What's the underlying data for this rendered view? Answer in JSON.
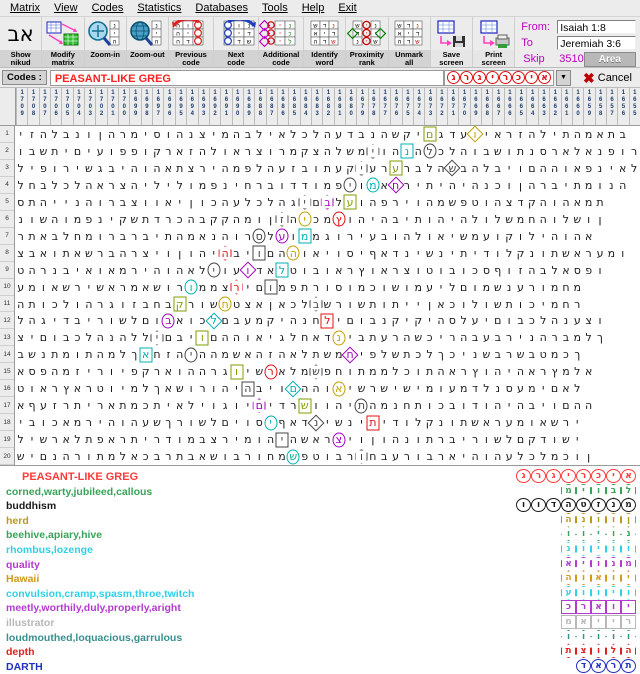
{
  "menu": {
    "items": [
      "Matrix",
      "View",
      "Codes",
      "Statistics",
      "Databases",
      "Tools",
      "Help",
      "Exit"
    ]
  },
  "toolbar": {
    "buttons": [
      {
        "label_line1": "Show",
        "label_line2": "nikud",
        "icon": "hebrew-aleph-nikud-icon"
      },
      {
        "label_line1": "Modify",
        "label_line2": "matrix",
        "icon": "modify-matrix-icon"
      },
      {
        "label_line1": "Zoom-in",
        "label_line2": "",
        "icon": "zoom-in-icon"
      },
      {
        "label_line1": "Zoom-out",
        "label_line2": "",
        "icon": "zoom-out-icon"
      },
      {
        "label_line1": "Previous",
        "label_line2": "code",
        "icon": "previous-code-icon"
      },
      {
        "label_line1": "Next",
        "label_line2": "code",
        "icon": "next-code-icon"
      },
      {
        "label_line1": "Additional",
        "label_line2": "code",
        "icon": "additional-code-icon"
      },
      {
        "label_line1": "Identify",
        "label_line2": "word",
        "icon": "identify-word-icon"
      },
      {
        "label_line1": "Proximity",
        "label_line2": "rank",
        "icon": "proximity-rank-icon"
      },
      {
        "label_line1": "Unmark",
        "label_line2": "all",
        "icon": "unmark-all-icon"
      },
      {
        "label_line1": "Save",
        "label_line2": "screen",
        "icon": "save-screen-icon"
      },
      {
        "label_line1": "Print",
        "label_line2": "screen",
        "icon": "print-screen-icon"
      }
    ],
    "range": {
      "from_label": "From:",
      "from_value": "Isaiah 1:8",
      "to_label": "To",
      "to_value": "Jeremiah 3:6",
      "skip_label": "Skip",
      "skip_value": "3510",
      "area_button": "Area"
    }
  },
  "codes_bar": {
    "label": "Codes :",
    "value": "PEASANT-LIKE GREG",
    "value_color": "#ff2020",
    "letters": [
      "ג",
      "ר",
      "ג",
      "י",
      "ר",
      "כ",
      "י",
      "א"
    ],
    "dropdown_icon": "chevron-down-icon",
    "cancel_label": "Cancel",
    "cancel_icon": "x-mark-icon"
  },
  "matrix": {
    "column_numbers": [
      1709,
      1708,
      1707,
      1706,
      1705,
      1704,
      1703,
      1702,
      1701,
      1700,
      1699,
      1698,
      1697,
      1696,
      1695,
      1694,
      1693,
      1692,
      1691,
      1690,
      1689,
      1688,
      1687,
      1686,
      1685,
      1684,
      1683,
      1682,
      1681,
      1680,
      1679,
      1678,
      1677,
      1676,
      1675,
      1674,
      1673,
      1672,
      1671,
      1670,
      1669,
      1668,
      1667,
      1666,
      1665,
      1664,
      1663,
      1662,
      1661,
      1660,
      1659,
      1658,
      1657,
      1656,
      1655
    ],
    "row_numbers": [
      1,
      2,
      3,
      4,
      5,
      6,
      7,
      8,
      9,
      10,
      11,
      12,
      13,
      14,
      15,
      16,
      17,
      18,
      19,
      20
    ],
    "rows": [
      "יזהלבנוןהרמיסוהנצימהבליאלכלהעדבנהשקיםגדעויארזהליתהמאתב",
      "ובשתיםיעופפוקראזהלוארצורמקצהלשמיוהנהלכלהובשותנסראלאנפור",
      "ליפורישגביהוהאתצריהמפלהעזבותעקיערערבלהשבהלביוםההואפניאל",
      "לחבלכלהארצהילילומפניחרבודדומפיומאחריתיהיהנכוןהרביתמונה",
      "סתהיינהורבצוואיןוכהעלכלהגיםבלעוהפריוהמשפטוהצדקהוהאמת",
      "נושהומפניקשתדרכהבקקהמוןזהיכמץוהיהביתוהיהלולשמחהולשון",
      "רתאבלחמורברביתהמאנהורסלעוממגוריעבוהלואישמעוקוליהוהא",
      "צבאותאשרבהרציוןוהיהביוםההואיוסיףאדנישניתידולקנותשארעמו",
      "טהרנביאואמריהוהאליועודאלטובוארץוארצוטובוכסףוזהבלאספו",
      "עמואשרישארמאשורוממצריםומפתרוסומכושומעילםומשנערומחמ",
      "התוכלוהרגוזבחבקרושחטצאןאכלבשרושתותייןאכולושתוכימחר",
      "להגידבירושלםובאוכלםבעמקיהנחליםובנקיקיהסלעיםובכלהנעצו",
      "ציםובכלהנהלליםביוםההואיגלחאדניבתערהשכירהבעברינהרבמלך",
      "בשנתמותהמלךאחזהיההמשאהזהאלתשמחיפלשתכלךכינשברשבטמכך",
      "אספהמזירויפקראוההרגוישראלמשפחותממלכותהארץוהיהארץמלא",
      "טוארץארטוימלךאשורוהיהביוםההואישרשישימועמדלנסעמיםאל",
      "אףעזרתיראתמכתיאליוגויםידרשווהיתהמנחתוכבודוהיהביוםהה",
      "יבוכאמריהוהעשךרושלםיוסיףאדנישניתידולקנותשארעמואשרי",
      "לישראלתפארתירדומבצרימוהיהשארציוןוהנותרבירושלםקדושי",
      "שיםנהרותמלאכברתבאשוברוחמשפטוברוחבערובראיהוהעלכלמכון"
    ],
    "markers": [
      {
        "row": 0,
        "col": 36,
        "shape": "rect",
        "color": "#7f9f00"
      },
      {
        "row": 0,
        "col": 40,
        "shape": "diamond",
        "color": "#c0a000"
      },
      {
        "row": 1,
        "col": 31,
        "shape": "hex",
        "color": "#444444"
      },
      {
        "row": 1,
        "col": 34,
        "shape": "rect",
        "color": "#00b0b0"
      },
      {
        "row": 1,
        "col": 36,
        "shape": "circle",
        "color": "#444444"
      },
      {
        "row": 2,
        "col": 30,
        "shape": "hex",
        "color": "#444444"
      },
      {
        "row": 2,
        "col": 33,
        "shape": "rect",
        "color": "#7f9f00"
      },
      {
        "row": 2,
        "col": 38,
        "shape": "diamond",
        "color": "#444444"
      },
      {
        "row": 3,
        "col": 29,
        "shape": "circle",
        "color": "#444444"
      },
      {
        "row": 3,
        "col": 31,
        "shape": "circle",
        "color": "#00b0b0"
      },
      {
        "row": 3,
        "col": 33,
        "shape": "diamond",
        "color": "#a000c0"
      },
      {
        "row": 4,
        "col": 25,
        "shape": "hex",
        "color": "#444444"
      },
      {
        "row": 4,
        "col": 27,
        "shape": "hex",
        "color": "#a000c0"
      },
      {
        "row": 4,
        "col": 29,
        "shape": "rect",
        "color": "#7f9f00"
      },
      {
        "row": 5,
        "col": 23,
        "shape": "hex",
        "color": "#444444"
      },
      {
        "row": 5,
        "col": 25,
        "shape": "circle",
        "color": "#c0a000"
      },
      {
        "row": 5,
        "col": 28,
        "shape": "circle",
        "color": "#e01010"
      },
      {
        "row": 6,
        "col": 21,
        "shape": "circle",
        "color": "#444444"
      },
      {
        "row": 6,
        "col": 23,
        "shape": "circle",
        "color": "#a000c0"
      },
      {
        "row": 6,
        "col": 25,
        "shape": "rect",
        "color": "#00b0b0"
      },
      {
        "row": 7,
        "col": 18,
        "shape": "hex",
        "color": "#e01010"
      },
      {
        "row": 7,
        "col": 21,
        "shape": "rect",
        "color": "#444444"
      },
      {
        "row": 7,
        "col": 24,
        "shape": "circle",
        "color": "#c0a000"
      },
      {
        "row": 8,
        "col": 17,
        "shape": "circle",
        "color": "#444444"
      },
      {
        "row": 8,
        "col": 20,
        "shape": "diamond",
        "color": "#a000c0"
      },
      {
        "row": 8,
        "col": 23,
        "shape": "rect",
        "color": "#00b0b0"
      },
      {
        "row": 9,
        "col": 15,
        "shape": "circle",
        "color": "#00b0b0"
      },
      {
        "row": 9,
        "col": 19,
        "shape": "hex",
        "color": "#e01010"
      },
      {
        "row": 9,
        "col": 22,
        "shape": "rect",
        "color": "#444444"
      },
      {
        "row": 10,
        "col": 14,
        "shape": "rect",
        "color": "#7f9f00"
      },
      {
        "row": 10,
        "col": 18,
        "shape": "circle",
        "color": "#c0a000"
      },
      {
        "row": 10,
        "col": 26,
        "shape": "hex",
        "color": "#444444"
      },
      {
        "row": 11,
        "col": 13,
        "shape": "circle",
        "color": "#a000c0"
      },
      {
        "row": 11,
        "col": 17,
        "shape": "diamond",
        "color": "#00b0b0"
      },
      {
        "row": 11,
        "col": 27,
        "shape": "rect",
        "color": "#e01010"
      },
      {
        "row": 12,
        "col": 12,
        "shape": "hex",
        "color": "#444444"
      },
      {
        "row": 12,
        "col": 16,
        "shape": "rect",
        "color": "#7f9f00"
      },
      {
        "row": 12,
        "col": 28,
        "shape": "circle",
        "color": "#c0a000"
      },
      {
        "row": 13,
        "col": 11,
        "shape": "rect",
        "color": "#00b0b0"
      },
      {
        "row": 13,
        "col": 15,
        "shape": "circle",
        "color": "#444444"
      },
      {
        "row": 13,
        "col": 29,
        "shape": "diamond",
        "color": "#a000c0"
      },
      {
        "row": 14,
        "col": 19,
        "shape": "rect",
        "color": "#7f9f00"
      },
      {
        "row": 14,
        "col": 22,
        "shape": "circle",
        "color": "#e01010"
      },
      {
        "row": 14,
        "col": 26,
        "shape": "hex",
        "color": "#444444"
      },
      {
        "row": 15,
        "col": 20,
        "shape": "rect",
        "color": "#444444"
      },
      {
        "row": 15,
        "col": 24,
        "shape": "diamond",
        "color": "#00b0b0"
      },
      {
        "row": 15,
        "col": 28,
        "shape": "circle",
        "color": "#c0a000"
      },
      {
        "row": 16,
        "col": 21,
        "shape": "hex",
        "color": "#a000c0"
      },
      {
        "row": 16,
        "col": 25,
        "shape": "rect",
        "color": "#7f9f00"
      },
      {
        "row": 16,
        "col": 30,
        "shape": "circle",
        "color": "#444444"
      },
      {
        "row": 17,
        "col": 22,
        "shape": "circle",
        "color": "#00b0b0"
      },
      {
        "row": 17,
        "col": 26,
        "shape": "diamond",
        "color": "#444444"
      },
      {
        "row": 17,
        "col": 31,
        "shape": "rect",
        "color": "#e01010"
      },
      {
        "row": 18,
        "col": 23,
        "shape": "rect",
        "color": "#444444"
      },
      {
        "row": 18,
        "col": 28,
        "shape": "circle",
        "color": "#a000c0"
      },
      {
        "row": 19,
        "col": 24,
        "shape": "circle",
        "color": "#00b0b0"
      },
      {
        "row": 19,
        "col": 30,
        "shape": "hex",
        "color": "#444444"
      }
    ]
  },
  "results": {
    "terms": [
      {
        "text": "PEASANT-LIKE GREG",
        "color": "#ff3b3b",
        "is_title": true
      },
      {
        "text": "corned,warty,jubileed,callous",
        "color": "#3aa35a",
        "is_title": false
      },
      {
        "text": "buddhism",
        "color": "#1a1a1a",
        "is_title": false
      },
      {
        "text": "herd",
        "color": "#b89a20",
        "is_title": false
      },
      {
        "text": "beehive,apiary,hive",
        "color": "#3aa35a",
        "is_title": false
      },
      {
        "text": "rhombus,lozenge",
        "color": "#2fd0e8",
        "is_title": false
      },
      {
        "text": "quality",
        "color": "#b43ad0",
        "is_title": false
      },
      {
        "text": "Hawaii",
        "color": "#d09a1a",
        "is_title": false
      },
      {
        "text": "convulsion,cramp,spasm,throe,twitch",
        "color": "#2fd0e8",
        "is_title": false
      },
      {
        "text": "meetly,worthily,duly,properly,aright",
        "color": "#b43ad0",
        "is_title": false
      },
      {
        "text": "illustrator",
        "color": "#b8b8b8",
        "is_title": false
      },
      {
        "text": "loudmouthed,loquacious,garrulous",
        "color": "#3a8f8f",
        "is_title": false
      },
      {
        "text": "depth",
        "color": "#e02020",
        "is_title": false
      },
      {
        "text": "DARTH",
        "color": "#2030c0",
        "is_title": false
      }
    ],
    "legend_rows": [
      {
        "letters": [
          "ג",
          "ר",
          "ג",
          "י",
          "ר",
          "כ",
          "י",
          "א"
        ],
        "color": "#ff3b3b",
        "shape": "circle"
      },
      {
        "letters": [
          "מ",
          "י",
          "ו",
          "ב",
          "ל"
        ],
        "color": "#3aa35a",
        "shape": "hex"
      },
      {
        "letters": [
          "ו",
          "ו",
          "ד",
          "ה",
          "ט",
          "ז",
          "נ",
          "מ"
        ],
        "color": "#1a1a1a",
        "shape": "circle"
      },
      {
        "letters": [
          "ה",
          "נ",
          "ו",
          "ו",
          "ן"
        ],
        "color": "#b89a20",
        "shape": "hex"
      },
      {
        "letters": [
          "ו",
          "ו",
          "י",
          "ו",
          "נ"
        ],
        "color": "#3aa35a",
        "shape": "diamond"
      },
      {
        "letters": [
          "נ",
          "ו",
          "י",
          "ו",
          "ו"
        ],
        "color": "#2fd0e8",
        "shape": "hex"
      },
      {
        "letters": [
          "א",
          "י",
          "ו",
          "נ",
          "מ"
        ],
        "color": "#b43ad0",
        "shape": "hex"
      },
      {
        "letters": [
          "ה",
          "ו",
          "א",
          "ו",
          "י"
        ],
        "color": "#d09a1a",
        "shape": "hex"
      },
      {
        "letters": [
          "ע",
          "ו",
          "ו",
          "י",
          "ו"
        ],
        "color": "#2fd0e8",
        "shape": "hex"
      },
      {
        "letters": [
          "כ",
          "ר",
          "א",
          "ו",
          "י"
        ],
        "color": "#b43ad0",
        "shape": "rect"
      },
      {
        "letters": [
          "מ",
          "א",
          "י",
          "י",
          "ר"
        ],
        "color": "#b8b8b8",
        "shape": "rect"
      },
      {
        "letters": [
          "ו",
          "ו",
          "ו",
          "ו",
          "ו"
        ],
        "color": "#3a8f8f",
        "shape": "diamond"
      },
      {
        "letters": [
          "ת",
          "צ",
          "ו",
          "ל",
          "ה"
        ],
        "color": "#e02020",
        "shape": "hex"
      },
      {
        "letters": [
          "ד",
          "א",
          "ר",
          "ת"
        ],
        "color": "#2030c0",
        "shape": "circle"
      }
    ]
  }
}
